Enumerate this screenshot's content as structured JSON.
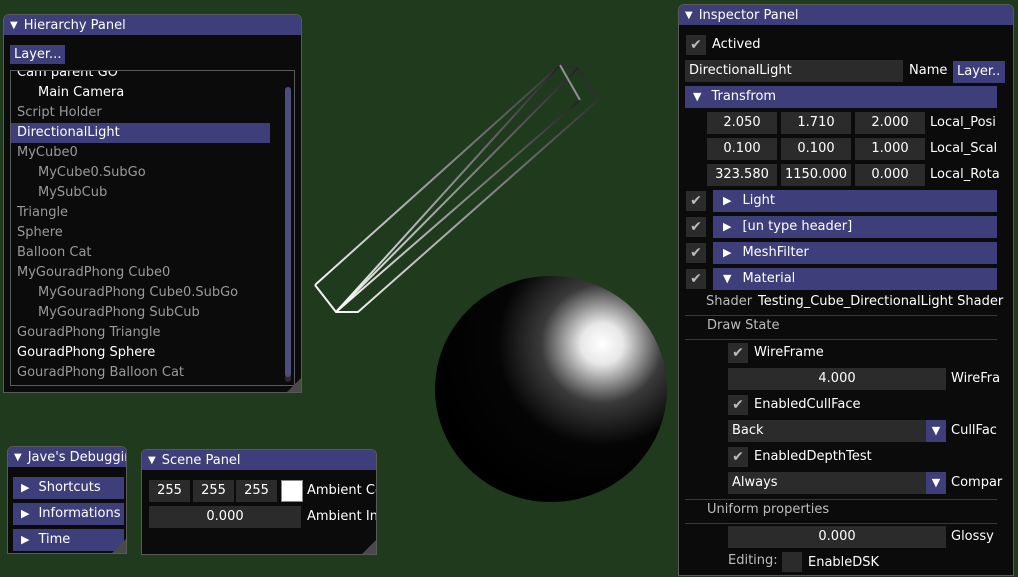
{
  "colors": {
    "background": "#1f3a1c",
    "title_bar": "#3e3f7a",
    "panel": "#0b0b0b",
    "field": "#2b2b2b"
  },
  "hierarchy": {
    "title": "Hierarchy Panel",
    "layer_button": "Layer...",
    "items": [
      {
        "label": "Cam parent GO",
        "indent": 0,
        "style": "bright"
      },
      {
        "label": "Main Camera",
        "indent": 1,
        "style": "bright"
      },
      {
        "label": "Script Holder",
        "indent": 0,
        "style": "dim"
      },
      {
        "label": "DirectionalLight",
        "indent": 0,
        "style": "selected"
      },
      {
        "label": "MyCube0",
        "indent": 0,
        "style": "dim"
      },
      {
        "label": "MyCube0.SubGo",
        "indent": 1,
        "style": "dim"
      },
      {
        "label": "MySubCub",
        "indent": 1,
        "style": "dim"
      },
      {
        "label": "Triangle",
        "indent": 0,
        "style": "dim"
      },
      {
        "label": "Sphere",
        "indent": 0,
        "style": "dim"
      },
      {
        "label": "Balloon Cat",
        "indent": 0,
        "style": "dim"
      },
      {
        "label": "MyGouradPhong Cube0",
        "indent": 0,
        "style": "dim"
      },
      {
        "label": "MyGouradPhong Cube0.SubGo",
        "indent": 1,
        "style": "dim"
      },
      {
        "label": "MyGouradPhong SubCub",
        "indent": 1,
        "style": "dim"
      },
      {
        "label": "GouradPhong Triangle",
        "indent": 0,
        "style": "dim"
      },
      {
        "label": "GouradPhong Sphere",
        "indent": 0,
        "style": "bright"
      },
      {
        "label": "GouradPhong Balloon Cat",
        "indent": 0,
        "style": "dim"
      }
    ]
  },
  "debug": {
    "title": "Jave's Debugging",
    "items": [
      "Shortcuts",
      "Informations",
      "Time"
    ]
  },
  "scene": {
    "title": "Scene Panel",
    "ambient_color": [
      "255",
      "255",
      "255"
    ],
    "ambient_color_label": "Ambient Co",
    "ambient_intensity": "0.000",
    "ambient_intensity_label": "Ambient In"
  },
  "inspector": {
    "title": "Inspector Panel",
    "actived_label": "Actived",
    "name_value": "DirectionalLight",
    "name_label": "Name",
    "layer_button": "Layer..",
    "transform": {
      "header": "Transfrom",
      "rows": [
        {
          "values": [
            "2.050",
            "1.710",
            "2.000"
          ],
          "label": "Local_Posi"
        },
        {
          "values": [
            "0.100",
            "0.100",
            "1.000"
          ],
          "label": "Local_Scal"
        },
        {
          "values": [
            "323.580",
            "1150.000",
            "0.000"
          ],
          "label": "Local_Rota"
        }
      ]
    },
    "components": [
      "Light",
      "[un type header]",
      "MeshFilter"
    ],
    "material": {
      "header": "Material",
      "shader_label": "Shader",
      "shader_value": "Testing_Cube_DirectionalLight Shader",
      "draw_state_label": "Draw State",
      "wireframe_label": "WireFrame",
      "wireframe_value": "4.000",
      "wireframe_field_label": "WireFra",
      "cullface_label": "EnabledCullFace",
      "cullface_value": "Back",
      "cullface_field_label": "CullFac",
      "depthtest_label": "EnabledDepthTest",
      "depthtest_value": "Always",
      "depthtest_field_label": "Compar",
      "uniform_label": "Uniform properties",
      "glossy_value": "0.000",
      "glossy_label": "Glossy",
      "editing_label": "Editing:",
      "enabledsk_label": "EnableDSK"
    }
  }
}
